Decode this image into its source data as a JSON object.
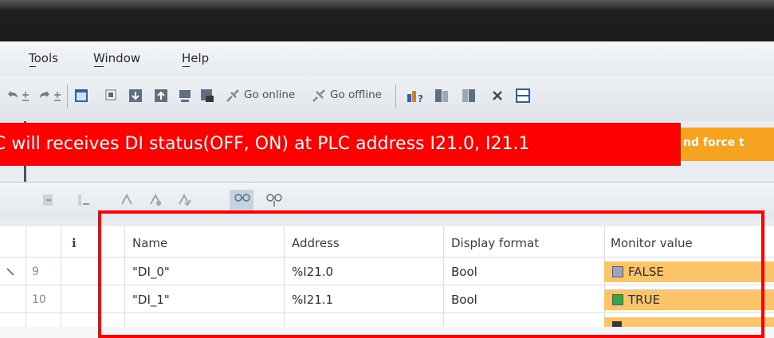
{
  "menu": {
    "tools": "Tools",
    "window": "Window",
    "help": "Help"
  },
  "toolbar": {
    "go_online": "Go online",
    "go_offline": "Go offline"
  },
  "annotation": {
    "caption": "C will receives DI status(OFF, ON) at PLC address I21.0, I21.1",
    "orange_fragment": "nd force t"
  },
  "table": {
    "info_header": "i",
    "columns": [
      "Name",
      "Address",
      "Display format",
      "Monitor value"
    ],
    "rows": [
      {
        "num": "9",
        "name": "\"DI_0\"",
        "address": "%I21.0",
        "format": "Bool",
        "monitor": "FALSE",
        "state": "false"
      },
      {
        "num": "10",
        "name": "\"DI_1\"",
        "address": "%I21.1",
        "format": "Bool",
        "monitor": "TRUE",
        "state": "true"
      }
    ]
  },
  "colors": {
    "caption_bg": "#ff0000",
    "monitor_bg": "#fbc469",
    "true_box": "#2fa84f",
    "false_box": "#9aa4c4"
  }
}
